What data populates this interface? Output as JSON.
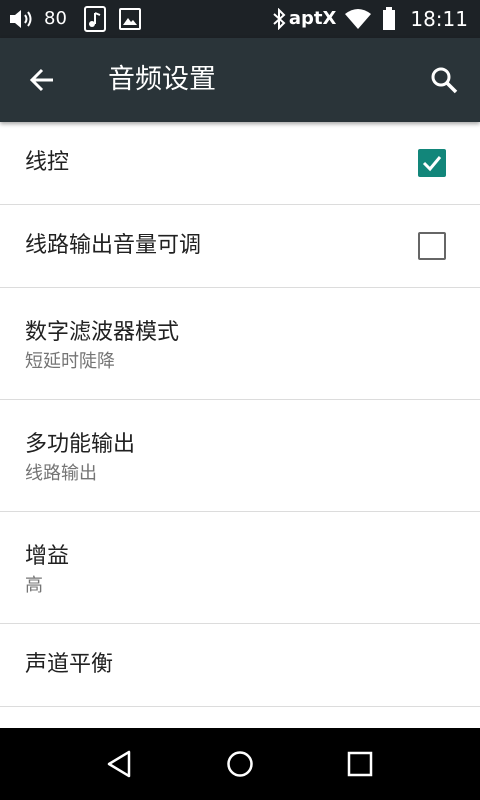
{
  "status_bar": {
    "volume_level": "80",
    "bluetooth_codec": "aptX",
    "time": "18:11",
    "icons": [
      "volume-icon",
      "music-file-icon",
      "image-icon",
      "bluetooth-icon",
      "wifi-icon",
      "battery-icon"
    ]
  },
  "toolbar": {
    "title": "音频设置",
    "back_icon": "arrow-back-icon",
    "search_icon": "search-icon"
  },
  "settings": {
    "line_control": {
      "title": "线控",
      "checked": true
    },
    "line_out_volume": {
      "title": "线路输出音量可调",
      "checked": false
    },
    "digital_filter": {
      "title": "数字滤波器模式",
      "value": "短延时陡降"
    },
    "multi_output": {
      "title": "多功能输出",
      "value": "线路输出"
    },
    "gain": {
      "title": "增益",
      "value": "高"
    },
    "channel_balance": {
      "title": "声道平衡"
    }
  },
  "nav_bar": {
    "icons": [
      "back-triangle-icon",
      "home-circle-icon",
      "recents-square-icon"
    ]
  },
  "colors": {
    "status_bar_bg": "#1d2226",
    "toolbar_bg": "#2a3439",
    "accent": "#12867a",
    "divider": "#dcdcdc"
  }
}
